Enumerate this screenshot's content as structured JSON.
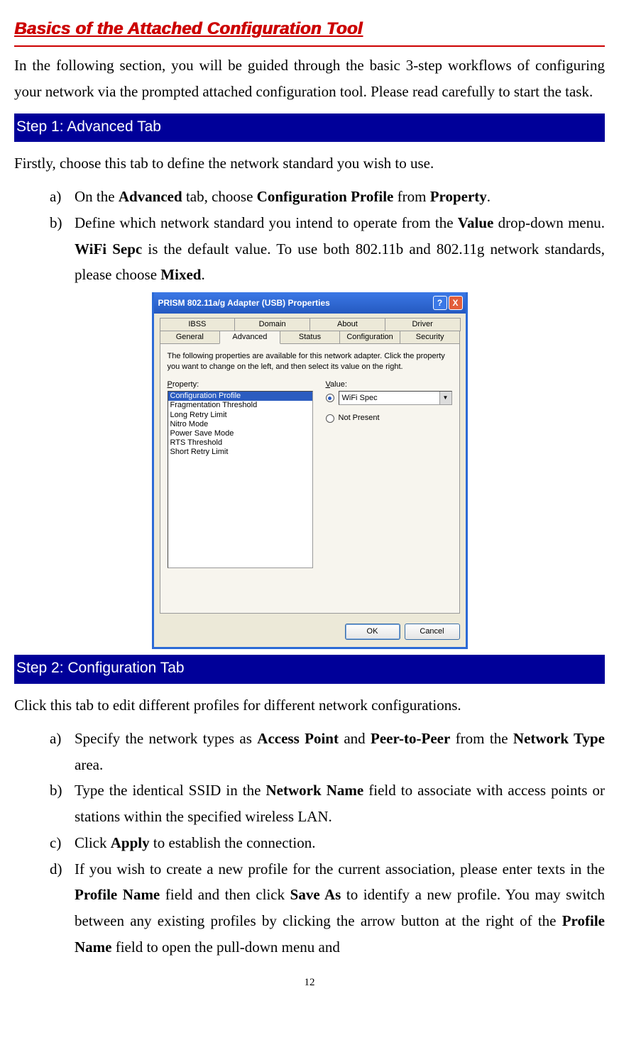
{
  "title": "Basics of the Attached Configuration Tool",
  "intro": "In the following section, you will be guided through the basic 3-step workflows of configuring your network via the prompted attached configuration tool. Please read carefully to start the task.",
  "step1": {
    "header": "Step 1: Advanced Tab",
    "lead": "Firstly, choose this tab to define the network standard you wish to use.",
    "items": {
      "a_marker": "a)",
      "a_t1": "On the ",
      "a_b1": "Advanced",
      "a_t2": " tab, choose ",
      "a_b2": "Configuration Profile",
      "a_t3": " from ",
      "a_b3": "Property",
      "a_t4": ".",
      "b_marker": "b)",
      "b_t1": "Define which network standard you intend to operate from the ",
      "b_b1": "Value",
      "b_t2": " drop-down menu. ",
      "b_b2": "WiFi Sepc",
      "b_t3": " is the default value. To use both 802.11b and 802.11g network standards, please choose ",
      "b_b3": "Mixed",
      "b_t4": "."
    }
  },
  "dialog": {
    "title": "PRISM 802.11a/g Adapter (USB) Properties",
    "tabs_top": [
      "IBSS",
      "Domain",
      "About",
      "Driver"
    ],
    "tabs_bottom": [
      "General",
      "Advanced",
      "Status",
      "Configuration",
      "Security"
    ],
    "active_tab": "Advanced",
    "desc": "The following properties are available for this network adapter. Click the property you want to change on the left, and then select its value on the right.",
    "property_label_u": "P",
    "property_label_rest": "roperty:",
    "value_label_u": "V",
    "value_label_rest": "alue:",
    "properties": [
      "Configuration Profile",
      "Fragmentation Threshold",
      "Long Retry Limit",
      "Nitro Mode",
      "Power Save Mode",
      "RTS Threshold",
      "Short Retry Limit"
    ],
    "selected_property": "Configuration Profile",
    "value_selected": "WiFi Spec",
    "not_present_u": "N",
    "not_present_rest": "ot Present",
    "ok": "OK",
    "cancel": "Cancel"
  },
  "step2": {
    "header": "Step 2: Configuration Tab",
    "lead": "Click this tab to edit different profiles for different network configurations.",
    "items": {
      "a_marker": "a)",
      "a_t1": "Specify the network types as ",
      "a_b1": "Access Point",
      "a_t2": " and ",
      "a_b2": "Peer-to-Peer",
      "a_t3": " from the ",
      "a_b3": "Network Type",
      "a_t4": " area.",
      "b_marker": "b)",
      "b_t1": "Type the identical SSID in the ",
      "b_b1": "Network Name",
      "b_t2": " field to associate with access points or stations within the specified wireless LAN.",
      "c_marker": "c)",
      "c_t1": "Click ",
      "c_b1": "Apply",
      "c_t2": " to establish the connection.",
      "d_marker": "d)",
      "d_t1": "If you wish to create a new profile for the current association, please enter texts in the ",
      "d_b1": "Profile Name",
      "d_t2": " field and then click ",
      "d_b2": "Save As",
      "d_t3": " to identify a new profile. You may switch between any existing profiles by clicking the arrow button at the right of the ",
      "d_b3": "Profile Name",
      "d_t4": " field to open the pull-down menu and"
    }
  },
  "page_number": "12"
}
